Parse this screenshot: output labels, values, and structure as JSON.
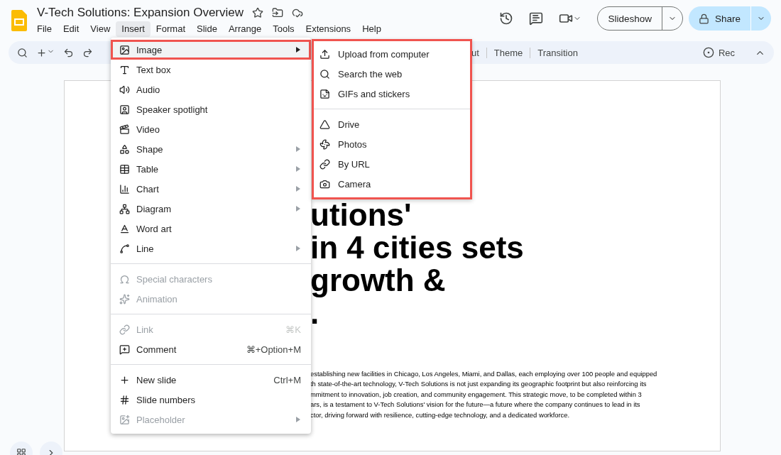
{
  "document": {
    "title": "V-Tech Solutions: Expansion Overview"
  },
  "menubar": [
    {
      "label": "File",
      "selected": false
    },
    {
      "label": "Edit",
      "selected": false
    },
    {
      "label": "View",
      "selected": false
    },
    {
      "label": "Insert",
      "selected": true
    },
    {
      "label": "Format",
      "selected": false
    },
    {
      "label": "Slide",
      "selected": false
    },
    {
      "label": "Arrange",
      "selected": false
    },
    {
      "label": "Tools",
      "selected": false
    },
    {
      "label": "Extensions",
      "selected": false
    },
    {
      "label": "Help",
      "selected": false
    }
  ],
  "header_buttons": {
    "slideshow": "Slideshow",
    "share": "Share"
  },
  "toolbar": {
    "items": [
      "ut",
      "Theme",
      "Transition"
    ],
    "record": "Rec"
  },
  "insert_menu": {
    "sections": [
      {
        "items": [
          {
            "label": "Image",
            "submenu": true,
            "disabled": false,
            "selected": true
          },
          {
            "label": "Text box",
            "submenu": false,
            "disabled": false,
            "selected": false
          },
          {
            "label": "Audio",
            "submenu": false,
            "disabled": false,
            "selected": false
          },
          {
            "label": "Speaker spotlight",
            "submenu": false,
            "disabled": false,
            "selected": false
          },
          {
            "label": "Video",
            "submenu": false,
            "disabled": false,
            "selected": false
          },
          {
            "label": "Shape",
            "submenu": true,
            "disabled": false,
            "selected": false
          },
          {
            "label": "Table",
            "submenu": true,
            "disabled": false,
            "selected": false
          },
          {
            "label": "Chart",
            "submenu": true,
            "disabled": false,
            "selected": false
          },
          {
            "label": "Diagram",
            "submenu": true,
            "disabled": false,
            "selected": false
          },
          {
            "label": "Word art",
            "submenu": false,
            "disabled": false,
            "selected": false
          },
          {
            "label": "Line",
            "submenu": true,
            "disabled": false,
            "selected": false
          }
        ]
      },
      {
        "items": [
          {
            "label": "Special characters",
            "submenu": false,
            "disabled": true,
            "selected": false
          },
          {
            "label": "Animation",
            "submenu": false,
            "disabled": true,
            "selected": false
          }
        ]
      },
      {
        "items": [
          {
            "label": "Link",
            "submenu": false,
            "disabled": true,
            "selected": false,
            "shortcut": "⌘K"
          },
          {
            "label": "Comment",
            "submenu": false,
            "disabled": false,
            "selected": false,
            "shortcut": "⌘+Option+M"
          }
        ]
      },
      {
        "items": [
          {
            "label": "New slide",
            "submenu": false,
            "disabled": false,
            "selected": false,
            "shortcut": "Ctrl+M"
          },
          {
            "label": "Slide numbers",
            "submenu": false,
            "disabled": false,
            "selected": false
          },
          {
            "label": "Placeholder",
            "submenu": true,
            "disabled": true,
            "selected": false
          }
        ]
      }
    ]
  },
  "image_submenu": {
    "sections": [
      {
        "items": [
          "Upload from computer",
          "Search the web",
          "GIFs and stickers"
        ]
      },
      {
        "items": [
          "Drive",
          "Photos",
          "By URL",
          "Camera"
        ]
      }
    ]
  },
  "slide": {
    "title_lines": [
      "utions'",
      "in 4 cities sets",
      "growth &",
      "."
    ],
    "body_lines": [
      "establishing new facilities in Chicago, Los Angeles, Miami, and Dallas, each employing over 100 people and equipped",
      "th state-of-the-art technology, V-Tech Solutions is not just expanding its geographic footprint but also reinforcing its",
      "mmitment to innovation, job creation, and community engagement. This strategic move, to be completed within 3",
      "ars, is a testament to V-Tech Solutions' vision for the future—a future where the company continues to lead in its",
      "ctor, driving forward with resilience, cutting-edge technology, and a dedicated workforce."
    ]
  }
}
